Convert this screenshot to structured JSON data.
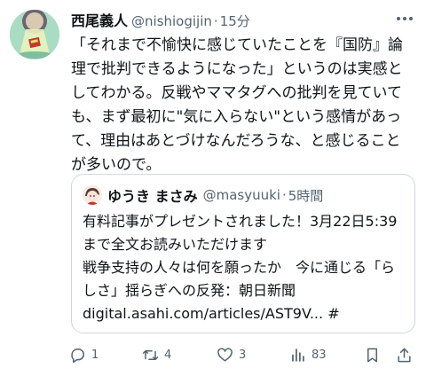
{
  "author": {
    "display_name": "西尾義人",
    "handle": "@nishiogijin",
    "separator": "·",
    "time": "15分"
  },
  "tweet": {
    "text": "「それまで不愉快に感じていたことを『国防』論理で批判できるようになった」というのは実感としてわかる。反戦やママタグへの批判を見ていても、まず最初に\"気に入らない\"という感情があって、理由はあとづけなんだろうな、と感じることが多いので。"
  },
  "quoted": {
    "display_name": "ゆうき まさみ",
    "handle": "@masyuuki",
    "separator": "·",
    "time": "5時間",
    "text": "有料記事がプレゼントされました！3月22日5:39まで全文お読みいただけます\n戦争支持の人々は何を願ったか　今に通じる「らしさ」揺らぎへの反発：朝日新聞\ndigital.asahi.com/articles/AST9V... #"
  },
  "actions": {
    "reply_count": "1",
    "retweet_count": "4",
    "like_count": "3",
    "views_count": "83"
  },
  "icons": {
    "more": "more-horizontal-icon",
    "reply": "reply-icon",
    "retweet": "retweet-icon",
    "like": "heart-icon",
    "views": "views-icon",
    "bookmark": "bookmark-icon",
    "share": "share-icon"
  },
  "colors": {
    "text_primary": "#0f1419",
    "text_secondary": "#536471",
    "border": "#cfd9de"
  }
}
